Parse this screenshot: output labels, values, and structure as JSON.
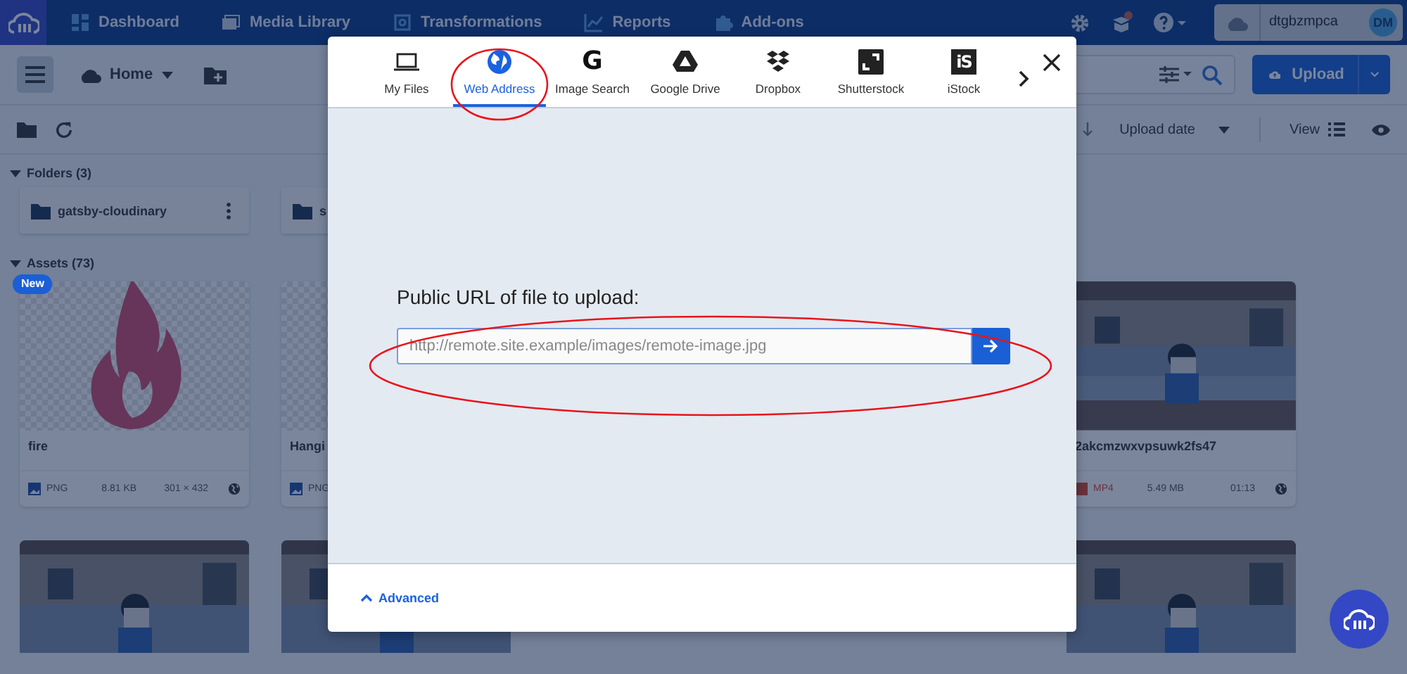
{
  "nav": {
    "items": [
      {
        "label": "Dashboard",
        "kind": "grid"
      },
      {
        "label": "Media Library",
        "kind": "images"
      },
      {
        "label": "Transformations",
        "kind": "frame"
      },
      {
        "label": "Reports",
        "kind": "chart"
      },
      {
        "label": "Add-ons",
        "kind": "puzzle"
      }
    ],
    "account": {
      "name": "dtgbzmpca",
      "initials": "DM"
    }
  },
  "toolbar": {
    "location": "Home",
    "upload_button": "Upload"
  },
  "sort": {
    "label": "Upload date",
    "view_label": "View"
  },
  "folders": {
    "title": "Folders (3)",
    "items": [
      {
        "name": "gatsby-cloudinary"
      },
      {
        "name": "s"
      }
    ]
  },
  "assets": {
    "title": "Assets (73)",
    "items": [
      {
        "name": "fire",
        "badge": "New",
        "kind": "fire",
        "format": "PNG",
        "size": "8.81 KB",
        "dimensions": "301 × 432",
        "public": true
      },
      {
        "name": "Hangi",
        "kind": "transparent",
        "format": "PNG"
      },
      {
        "name": "2akcmzwxvpsuwk2fs47",
        "kind": "video",
        "format": "MP4",
        "size": "5.49 MB",
        "duration": "01:13",
        "public": true
      }
    ]
  },
  "dialog": {
    "tabs": [
      {
        "label": "My Files",
        "kind": "laptop",
        "selected": false
      },
      {
        "label": "Web Address",
        "kind": "globe",
        "selected": true
      },
      {
        "label": "Image Search",
        "kind": "glyph",
        "glyph": "G",
        "selected": false
      },
      {
        "label": "Google Drive",
        "kind": "drive",
        "selected": false
      },
      {
        "label": "Dropbox",
        "kind": "dropbox",
        "selected": false
      },
      {
        "label": "Shutterstock",
        "kind": "frame",
        "selected": false
      },
      {
        "label": "iStock",
        "kind": "badge",
        "glyph": "iS",
        "selected": false
      }
    ],
    "url_prompt": "Public URL of file to upload:",
    "url_placeholder": "http://remote.site.example/images/remote-image.jpg",
    "advanced": "Advanced"
  }
}
